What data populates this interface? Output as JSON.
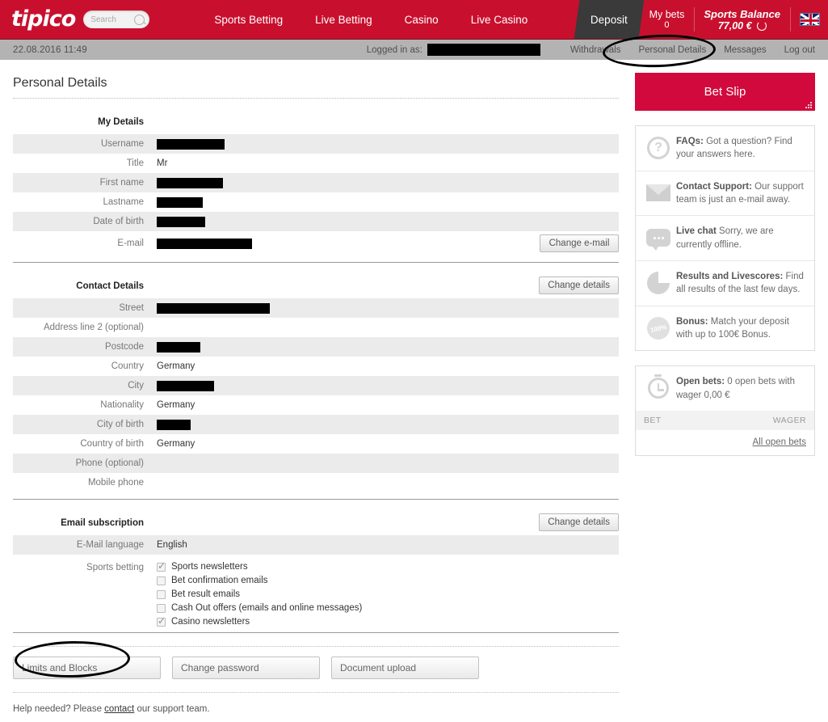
{
  "header": {
    "logo": "tipico",
    "search_placeholder": "Search",
    "nav": [
      {
        "label": "Sports Betting"
      },
      {
        "label": "Live Betting"
      },
      {
        "label": "Casino"
      },
      {
        "label": "Live Casino"
      }
    ],
    "deposit_label": "Deposit",
    "my_bets_label": "My bets",
    "my_bets_count": "0",
    "balance_label": "Sports Balance",
    "balance_value": "77,00 €",
    "refresh_icon": "refresh-icon",
    "flag_icon": "uk-flag-icon"
  },
  "subbar": {
    "datetime": "22.08.2016  11:49",
    "logged_in_label": "Logged in as:",
    "links": [
      {
        "label": "Withdrawals"
      },
      {
        "label": "Personal Details"
      },
      {
        "label": "Messages"
      },
      {
        "label": "Log out"
      }
    ]
  },
  "page": {
    "title": "Personal Details"
  },
  "my_details": {
    "section_title": "My Details",
    "rows": [
      {
        "label": "Username",
        "value": "",
        "redacted": 84
      },
      {
        "label": "Title",
        "value": "Mr",
        "redacted": 0
      },
      {
        "label": "First name",
        "value": "",
        "redacted": 82
      },
      {
        "label": "Lastname",
        "value": "",
        "redacted": 57
      },
      {
        "label": "Date of birth",
        "value": "",
        "redacted": 60
      },
      {
        "label": "E-mail",
        "value": "",
        "redacted": 118
      }
    ],
    "change_email_label": "Change e-mail"
  },
  "contact_details": {
    "section_title": "Contact Details",
    "change_details_label": "Change details",
    "rows": [
      {
        "label": "Street",
        "value": "",
        "redacted": 140
      },
      {
        "label": "Address line 2 (optional)",
        "value": "",
        "redacted": 0
      },
      {
        "label": "Postcode",
        "value": "",
        "redacted": 54
      },
      {
        "label": "Country",
        "value": "Germany",
        "redacted": 0
      },
      {
        "label": "City",
        "value": "",
        "redacted": 71
      },
      {
        "label": "Nationality",
        "value": "Germany",
        "redacted": 0
      },
      {
        "label": "City of birth",
        "value": "",
        "redacted": 42
      },
      {
        "label": "Country of birth",
        "value": "Germany",
        "redacted": 0
      },
      {
        "label": "Phone (optional)",
        "value": "",
        "redacted": 0
      },
      {
        "label": "Mobile phone",
        "value": "",
        "redacted": 0
      }
    ]
  },
  "email_subscription": {
    "section_title": "Email subscription",
    "change_details_label": "Change details",
    "language_label": "E-Mail language",
    "language_value": "English",
    "sports_betting_label": "Sports betting",
    "checkboxes": [
      {
        "label": "Sports newsletters",
        "checked": true
      },
      {
        "label": "Bet confirmation emails",
        "checked": false
      },
      {
        "label": "Bet result emails",
        "checked": false
      },
      {
        "label": "Cash Out offers (emails and online messages)",
        "checked": false
      },
      {
        "label": "Casino newsletters",
        "checked": true
      }
    ]
  },
  "bottom_buttons": [
    {
      "label": "Limits and Blocks"
    },
    {
      "label": "Change password"
    },
    {
      "label": "Document upload"
    }
  ],
  "help": {
    "prefix": "Help needed? Please ",
    "link": "contact",
    "suffix": " our support team."
  },
  "sidebar": {
    "bet_slip_title": "Bet Slip",
    "help_cards": [
      {
        "icon": "question-mark-icon",
        "bold": "FAQs:",
        "text": " Got a question? Find your answers here."
      },
      {
        "icon": "envelope-icon",
        "bold": "Contact Support:",
        "text": " Our support team is just an e-mail away."
      },
      {
        "icon": "chat-bubble-icon",
        "bold": "Live chat",
        "text": " Sorry, we are currently offline."
      },
      {
        "icon": "pie-chart-icon",
        "bold": "Results and Livescores:",
        "text": " Find all results of the last few days."
      },
      {
        "icon": "bonus-badge-icon",
        "bold": "Bonus:",
        "text": " Match your deposit with up to 100€ Bonus."
      }
    ],
    "open_bets": {
      "icon": "stopwatch-icon",
      "bold": "Open bets:",
      "text": " 0 open bets with wager 0,00 €",
      "col_bet": "BET",
      "col_wager": "WAGER",
      "all_open_bets": "All open bets"
    }
  },
  "colors": {
    "brand_red": "#c8102e",
    "betslip_red": "#d2093c",
    "deposit_dark": "#3a3a3a",
    "subbar_gray": "#b3b3b3",
    "row_alt": "#ebebeb"
  }
}
